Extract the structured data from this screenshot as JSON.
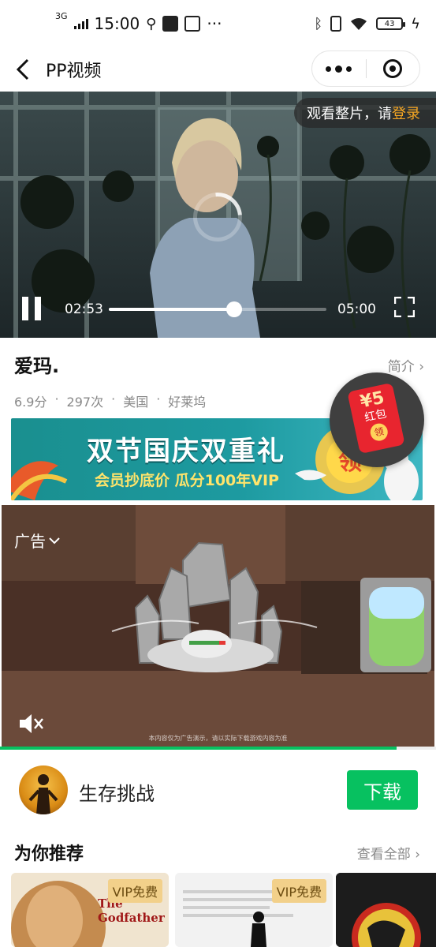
{
  "status_bar": {
    "network": "3G",
    "time": "15:00",
    "ellipsis": "···",
    "battery": "43"
  },
  "nav": {
    "back_icon": "chevron-left-icon",
    "title": "PP视频"
  },
  "video": {
    "login_prompt": "观看整片，请",
    "login_link": "登录",
    "current_time": "02:53",
    "duration": "05:00",
    "progress_fraction": 0.577
  },
  "movie": {
    "title": "爱玛.",
    "intro_link": "简介",
    "rating": "6.9分",
    "plays": "297次",
    "region": "美国",
    "studio": "好莱坞"
  },
  "promo": {
    "headline": "双节国庆双重礼",
    "subline": "会员抄底价  瓜分100年VIP",
    "badge": "领"
  },
  "red_packet": {
    "amount": "¥5",
    "label": "红包",
    "action": "领"
  },
  "ad": {
    "label": "广告",
    "caption": "本内容仅为广告演示，请以实际下载游戏内容为准",
    "progress_fraction": 0.91
  },
  "app": {
    "name": "生存挑战",
    "download_label": "下载"
  },
  "recommend": {
    "title": "为你推荐",
    "see_all": "查看全部",
    "items": [
      {
        "poster_text": "The Godfather",
        "badge": "VIP免费"
      },
      {
        "poster_text": "",
        "badge": "VIP免费"
      },
      {
        "poster_text": "",
        "badge": ""
      }
    ]
  },
  "colors": {
    "accent_green": "#07c160",
    "login_orange": "#f5a623",
    "vip_gold": "#f2d08a"
  }
}
